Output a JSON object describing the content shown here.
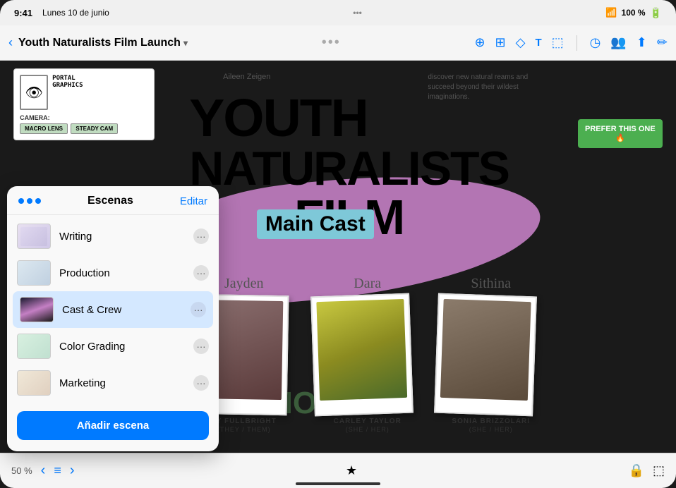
{
  "statusBar": {
    "time": "9:41",
    "date": "Lunes 10 de junio",
    "battery": "100 %",
    "wifi": "WiFi"
  },
  "toolbar": {
    "backLabel": "‹",
    "title": "Youth Naturalists Film Launch",
    "chevron": "▾",
    "dotsLabel": "•••",
    "icons": {
      "circle": "○",
      "browser": "⬜",
      "shapes": "⬦",
      "text": "T",
      "image": "⬚",
      "share": "⬆",
      "pen": "✏",
      "people": "👥",
      "clock": "◷"
    }
  },
  "canvas": {
    "aileenLabel": "Aileen Zeigen",
    "topRightText": "discover new natural reams and succeed beyond their wildest imaginations.",
    "titleYouth": "YOUTH",
    "titleNaturalists": "NAtURALISTS",
    "titleFilm": "FILM",
    "mainCastLabel": "Main Cast",
    "auditionsText": "DITIONS",
    "castMembers": [
      {
        "name": "TY FULLBRIGHT",
        "pronouns": "(THEY / THEM)",
        "sig": "Jayden"
      },
      {
        "name": "CARLEY TAYLOR",
        "pronouns": "(SHE / HER)",
        "sig": "Dara"
      },
      {
        "name": "SONIA BRIZZOLARI",
        "pronouns": "(SHE / HER)",
        "sig": "Sithina"
      }
    ],
    "preferNote": "PREFER THIS ONE 🔥",
    "cameraLabel": "CAMERA:",
    "macroLens": "MACRO LENS",
    "steadyCam": "STEADY CAM"
  },
  "panel": {
    "title": "Escenas",
    "editLabel": "Editar",
    "dotsLabel": "•••",
    "scenes": [
      {
        "name": "Writing",
        "active": false
      },
      {
        "name": "Production",
        "active": false
      },
      {
        "name": "Cast & Crew",
        "active": true
      },
      {
        "name": "Color Grading",
        "active": false
      },
      {
        "name": "Marketing",
        "active": false
      }
    ],
    "addSceneLabel": "Añadir escena"
  },
  "bottomBar": {
    "zoomLevel": "50 %",
    "prevArrow": "‹",
    "nextArrow": "›",
    "listIcon": "≡",
    "starIcon": "★",
    "lockIcon": "🔒",
    "layoutIcon": "⬚"
  }
}
